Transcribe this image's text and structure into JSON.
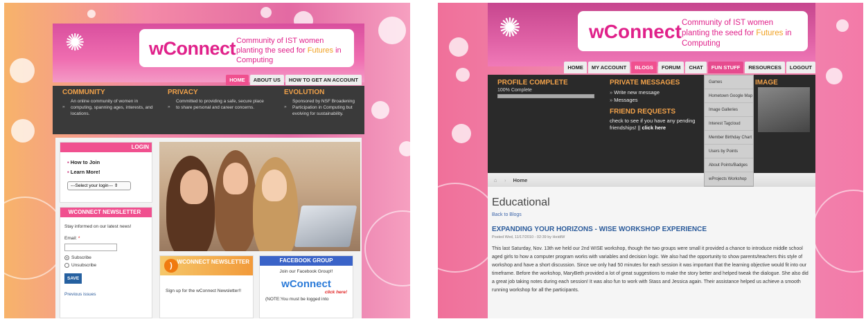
{
  "left": {
    "logo": "wConnect",
    "tagline_pre": "Community of IST women planting the seed for ",
    "tagline_fut": "Futures",
    "tagline_post": " in Computing",
    "nav": [
      "HOME",
      "ABOUT US",
      "HOW TO GET AN ACCOUNT"
    ],
    "columns": [
      {
        "title": "COMMUNITY",
        "text": "An online community of women in computing, spanning ages, interests, and locations."
      },
      {
        "title": "PRIVACY",
        "text": "Committed to providing a safe, secure place to share personal and career concerns."
      },
      {
        "title": "EVOLUTION",
        "text": "Sponsored by NSF Broadening Participation in Computing but evolving for sustainability."
      }
    ],
    "login": {
      "title": "LOGIN",
      "links": [
        "How to Join",
        "Learn More!"
      ],
      "select": "---Select your login--- ⇕"
    },
    "newsletter": {
      "title": "WCONNECT NEWSLETTER",
      "intro": "Stay informed on our latest news!",
      "email_label": "Email:",
      "required": "*",
      "subscribe": "Subscribe",
      "unsubscribe": "Unsubscribe",
      "save": "SAVE",
      "previous": "Previous issues"
    },
    "rss_widget": {
      "title": "WCONNECT NEWSLETTER",
      "text": "Sign up for the wConnect Newsletter!!"
    },
    "fb_widget": {
      "title": "FACEBOOK GROUP",
      "text": "Join our Facebook Group!!",
      "logo": "wConnect",
      "click": "click here!",
      "note": "(NOTE:You must be logged into"
    }
  },
  "right": {
    "logo": "wConnect",
    "tagline_pre": "Community of IST women planting the seed for ",
    "tagline_fut": "Futures",
    "tagline_post": " in Computing",
    "nav": [
      "HOME",
      "MY ACCOUNT",
      "BLOGS",
      "FORUM",
      "CHAT",
      "FUN STUFF",
      "RESOURCES",
      "LOGOUT"
    ],
    "profile": {
      "title": "PROFILE COMPLETE",
      "progress_label": "100% Complete",
      "progress": 1.0
    },
    "pm": {
      "title": "PRIVATE MESSAGES",
      "items": [
        "Write new message",
        "Messages"
      ]
    },
    "fr": {
      "title": "FRIEND REQUESTS",
      "text": "check to see if you have any pending friendships! ||",
      "link": "click here"
    },
    "image_title": "IMAGE",
    "dropdown": [
      "Games",
      "Hometown Google Map",
      "Image Galleries",
      "Interest Tagcloud",
      "Member Birthday Chart",
      "Users by Points",
      "About Points/Badges",
      "wProjects Workshop"
    ],
    "crumb": "Home",
    "page_title": "Educational",
    "back": "Back to Blogs",
    "post_title": "EXPANDING YOUR HORIZONS - WISE WORKSHOP EXPERIENCE",
    "posted": "Posted Wed, 11/17/2010 - 02:39 by HeidiW",
    "body": "This last Saturday, Nov. 13th we held our 2nd WISE workshop, though the two groups were small it provided a chance to introduce middle school aged girls to how a computer program works with variables and decision logic.  We also had the opportunity to show parents/teachers this style of workshop and have a short discussion.  Since we only had 50 minutes for each session it was important that the learning objective would fit into our timeframe.  Before the workshop, MaryBeth provided a lot of great suggestions to make the story better and helped tweak the dialogue. She also did a great job taking notes during each session! It was also fun to work with Stass and Jessica again. Their assistance helped us achieve a smooth running workshop for all the participants."
  },
  "colors": {
    "pink": "#f0508f",
    "magenta": "#e0218a",
    "orange": "#f2a24a",
    "dark": "#3a3a3a",
    "blue": "#2a5a9a"
  }
}
